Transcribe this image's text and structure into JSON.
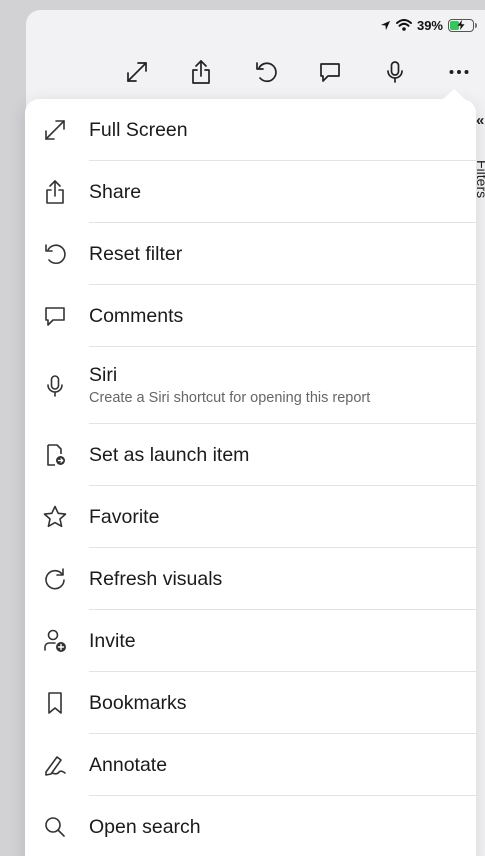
{
  "status_bar": {
    "battery_text": "39%",
    "battery_level": 0.39,
    "battery_color": "#34c759"
  },
  "toolbar": {
    "buttons": [
      {
        "icon": "expand-icon"
      },
      {
        "icon": "share-icon"
      },
      {
        "icon": "reset-icon"
      },
      {
        "icon": "comment-icon"
      },
      {
        "icon": "microphone-icon"
      },
      {
        "icon": "more-icon"
      }
    ]
  },
  "side_panel": {
    "collapse_glyph": "«",
    "label": "Filters"
  },
  "menu": {
    "items": [
      {
        "label": "Full Screen",
        "icon": "expand-icon"
      },
      {
        "label": "Share",
        "icon": "share-icon"
      },
      {
        "label": "Reset filter",
        "icon": "reset-icon"
      },
      {
        "label": "Comments",
        "icon": "comment-icon"
      },
      {
        "label": "Siri",
        "subtitle": "Create a Siri shortcut for opening this report",
        "icon": "microphone-icon"
      },
      {
        "label": "Set as launch item",
        "icon": "launch-item-icon"
      },
      {
        "label": "Favorite",
        "icon": "star-icon"
      },
      {
        "label": "Refresh visuals",
        "icon": "refresh-icon"
      },
      {
        "label": "Invite",
        "icon": "invite-icon"
      },
      {
        "label": "Bookmarks",
        "icon": "bookmark-icon"
      },
      {
        "label": "Annotate",
        "icon": "pen-icon"
      },
      {
        "label": "Open search",
        "icon": "search-icon"
      }
    ]
  }
}
